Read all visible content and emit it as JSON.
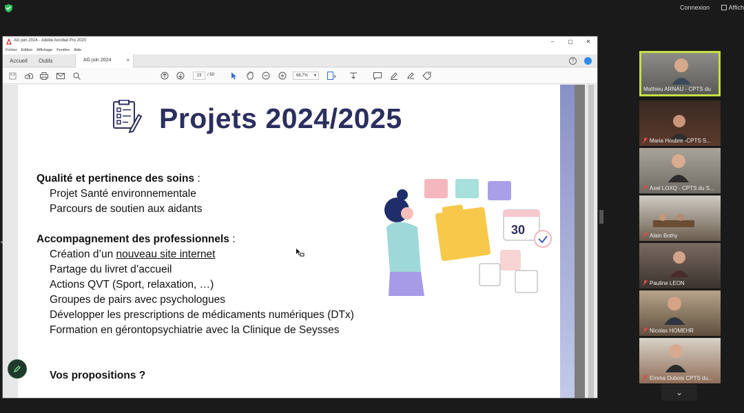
{
  "zoom_top": {
    "connexion": "Connexion",
    "affiche": "Affich"
  },
  "acrobat": {
    "title": "AG juin 2024 - Adobe Acrobat Pro 2020",
    "menu": [
      "Fichier",
      "Edition",
      "Affichage",
      "Fenêtre",
      "Aide"
    ],
    "tabs": {
      "home": "Accueil",
      "tools": "Outils",
      "doc": "AG juin 2024"
    },
    "page_current": "23",
    "page_total": "/ 50",
    "zoom": "68,7%"
  },
  "slide": {
    "title": "Projets 2024/2025",
    "section1_title": "Qualité et pertinence des soins",
    "section1_suffix": " :",
    "section1_items": [
      "Projet Santé environnementale",
      "Parcours de soutien aux aidants"
    ],
    "section2_title": "Accompagnement des professionnels",
    "section2_suffix": " :",
    "section2_item0_prefix": "Création d’un ",
    "section2_item0_link": "nouveau site internet",
    "section2_items": [
      "Partage du livret d’accueil",
      "Actions QVT (Sport, relaxation, …)",
      "Groupes de pairs avec psychologues",
      "Développer les prescriptions de médicaments numériques (DTx)",
      "Formation en gérontopsychiatrie avec la Clinique de Seysses"
    ],
    "propositions": "Vos propositions ?",
    "calendar_day": "30"
  },
  "participants": [
    {
      "name": "Mathieu ARNAU - CPTS du Sud...",
      "active": true
    },
    {
      "name": "Maria Houbre -CPTS S..."
    },
    {
      "name": "Axel LOXQ - CPTS du S..."
    },
    {
      "name": "Alain Bothy"
    },
    {
      "name": "Pauline LEON"
    },
    {
      "name": "Nicolas HOMEHR"
    },
    {
      "name": "Emma Dubois CPTS du..."
    }
  ],
  "colors": {
    "title": "#2b2f5e",
    "active_border": "#c6e042",
    "mic_muted": "#e04b4b"
  }
}
